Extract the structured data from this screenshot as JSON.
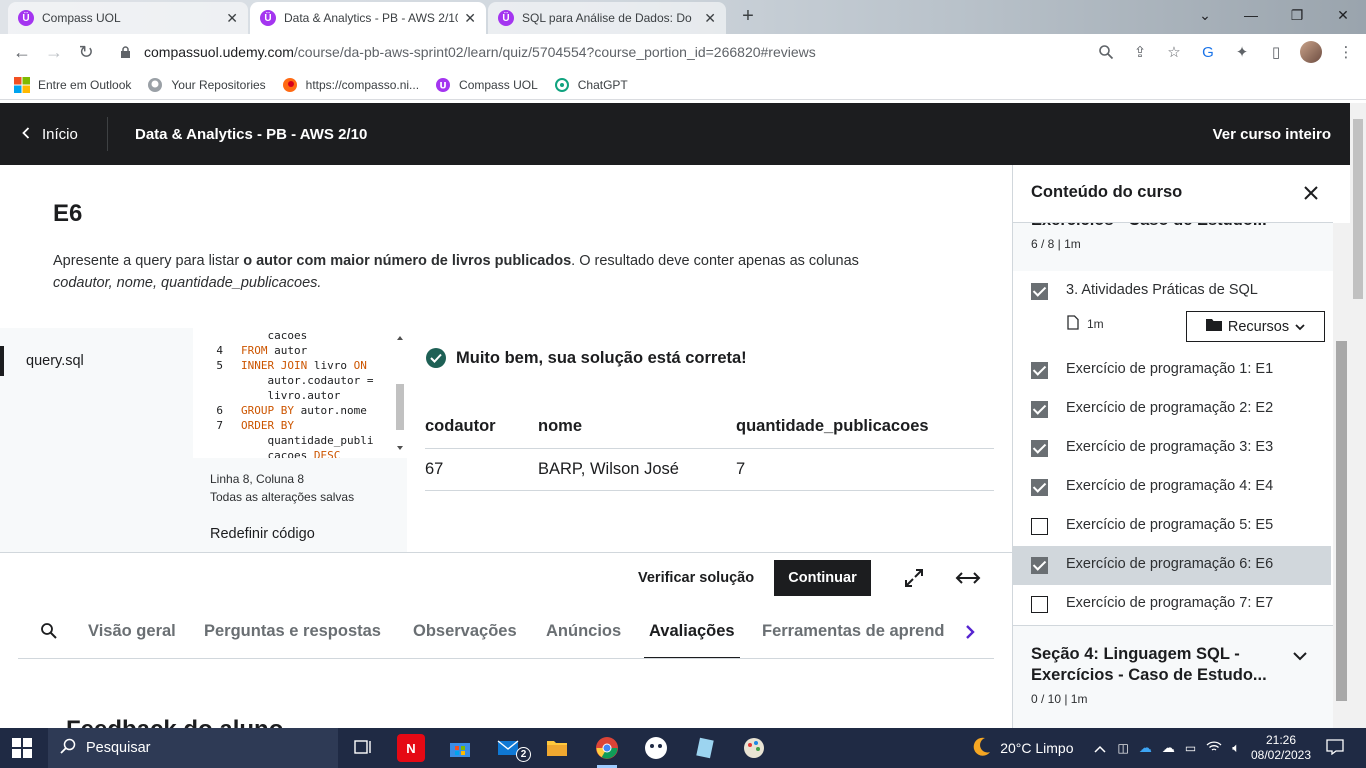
{
  "browser": {
    "tabs": [
      {
        "title": "Compass UOL",
        "active": false
      },
      {
        "title": "Data & Analytics - PB - AWS 2/10",
        "active": true
      },
      {
        "title": "SQL para Análise de Dados: Do",
        "active": false
      }
    ],
    "url_host": "compassuol.udemy.com",
    "url_path": "/course/da-pb-aws-sprint02/learn/quiz/5704554?course_portion_id=266820#reviews",
    "bookmarks": [
      "Entre em Outlook",
      "Your Repositories",
      "https://compasso.ni...",
      "Compass UOL",
      "ChatGPT"
    ]
  },
  "header": {
    "back_label": "Início",
    "course_title": "Data & Analytics - PB - AWS 2/10",
    "view_course": "Ver curso inteiro"
  },
  "quiz": {
    "title": "E6",
    "desc_start": "Apresente a query para listar ",
    "desc_bold": "o autor com maior número de livros publicados",
    "desc_end": ". O resultado deve conter apenas as colunas",
    "desc_cols": "codautor, nome, quantidade_publicacoes."
  },
  "editor": {
    "file_name": "query.sql",
    "status_pos": "Linha 8, Coluna 8",
    "status_saved": "Todas as alterações salvas",
    "reset": "Redefinir código",
    "lines": [
      {
        "n": "",
        "kw": "",
        "txt": "    cacoes"
      },
      {
        "n": "4",
        "kw": "FROM",
        "txt": " autor"
      },
      {
        "n": "5",
        "kw": "INNER JOIN",
        "txt": " livro ",
        "kw2": "ON"
      },
      {
        "n": "",
        "kw": "",
        "txt": "    autor.codautor ="
      },
      {
        "n": "",
        "kw": "",
        "txt": "    livro.autor"
      },
      {
        "n": "6",
        "kw": "GROUP BY",
        "txt": " autor.nome"
      },
      {
        "n": "7",
        "kw": "ORDER BY",
        "txt": ""
      },
      {
        "n": "",
        "kw": "",
        "txt": "    quantidade_publi"
      },
      {
        "n": "",
        "kw": "",
        "txt": "    cacoes ",
        "kw2": "DESC"
      }
    ]
  },
  "result": {
    "message": "Muito bem, sua solução está correta!",
    "columns": [
      "codautor",
      "nome",
      "quantidade_publicacoes"
    ],
    "row": [
      "67",
      "BARP, Wilson José",
      "7"
    ]
  },
  "actions": {
    "verify": "Verificar solução",
    "continue": "Continuar"
  },
  "bottom_tabs": [
    "Visão geral",
    "Perguntas e respostas",
    "Observações",
    "Anúncios",
    "Avaliações",
    "Ferramentas de aprend"
  ],
  "active_tab": "Avaliações",
  "feedback_title": "Feedback do aluno",
  "sidebar": {
    "title": "Conteúdo do curso",
    "prev_section_cut": "Exercícios - Caso de Estudo...",
    "prev_section_meta": "6 / 8 | 1m",
    "lecture": {
      "label": "3. Atividades Práticas de SQL",
      "duration": "1m",
      "resources": "Recursos",
      "done": true
    },
    "items": [
      {
        "label": "Exercício de programação 1: E1",
        "done": true
      },
      {
        "label": "Exercício de programação 2: E2",
        "done": true
      },
      {
        "label": "Exercício de programação 3: E3",
        "done": true
      },
      {
        "label": "Exercício de programação 4: E4",
        "done": true
      },
      {
        "label": "Exercício de programação 5: E5",
        "done": false
      },
      {
        "label": "Exercício de programação 6: E6",
        "done": true,
        "current": true
      },
      {
        "label": "Exercício de programação 7: E7",
        "done": false
      }
    ],
    "next_section_title": "Seção 4: Linguagem SQL - Exercícios - Caso de Estudo...",
    "next_section_meta": "0 / 10 | 1m"
  },
  "taskbar": {
    "search": "Pesquisar",
    "weather": "20°C  Limpo",
    "time": "21:26",
    "date": "08/02/2023",
    "mail_badge": "2"
  }
}
